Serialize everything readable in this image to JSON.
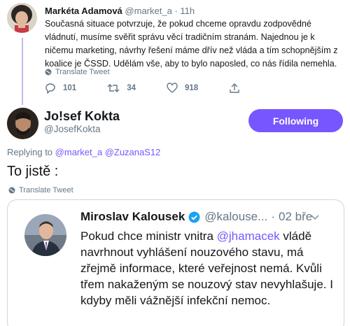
{
  "parent_tweet": {
    "author_name": "Markéta Adamová",
    "author_handle": "@market_a",
    "separator": "·",
    "time": "11h",
    "text": "Současná situace potvrzuje, že pokud chceme opravdu zodpovědné vládnutí, musíme svěřit správu věcí tradičním stranám. Najednou je k ničemu marketing, návrhy řešení máme dřív než vláda a tím schopnějším z koalice je ČSSD. Udělám vše, aby to bylo naposled, co nás řídila nemehla.",
    "translate_label": "Translate Tweet",
    "reply_count": "101",
    "retweet_count": "34",
    "like_count": "918"
  },
  "main_tweet": {
    "author_name": "Jo!sef Kokta",
    "author_handle": "@JosefKokta",
    "follow_label": "Following",
    "replying_prefix": "Replying to",
    "reply_mention_1": "@market_a",
    "reply_mention_2": "@ZuzanaS12",
    "text": "To jistě :",
    "translate_label": "Translate Tweet"
  },
  "quoted_tweet": {
    "author_name": "Miroslav Kalousek",
    "author_handle": "@kalouse...",
    "separator": "·",
    "time": "02 bře",
    "text_before": "Pokud chce ministr vnitra ",
    "mention": "@jhamacek",
    "text_after": " vládě navrhnout vyhlášení nouzového stavu, má zřejmě informace, které veřejnost nemá. Kvůli třem nakaženým se nouzový stav nevyhlašuje. I kdyby měli vážnější infekční nemoc."
  },
  "colors": {
    "accent": "#7856ff",
    "muted": "#657786",
    "thread_line": "#c4b5f4",
    "verified": "#1da1f2"
  }
}
